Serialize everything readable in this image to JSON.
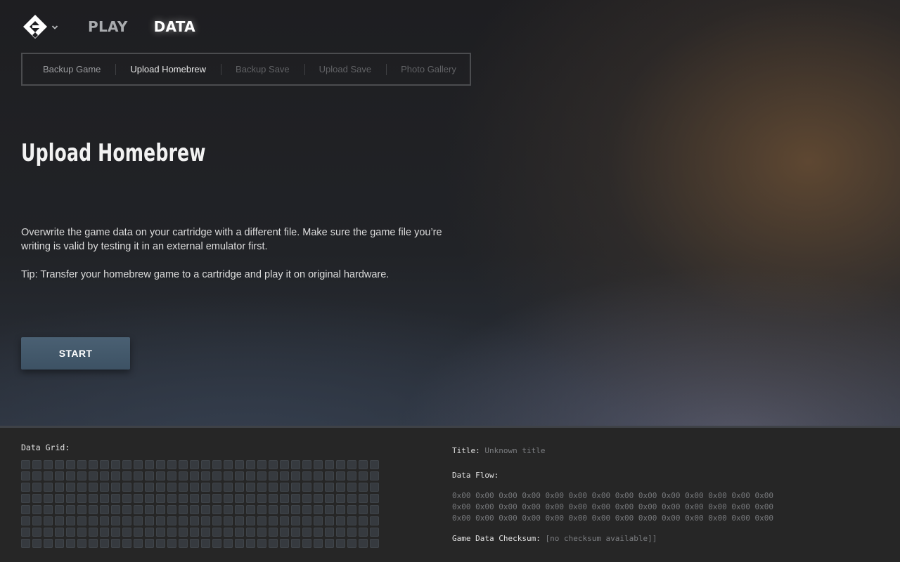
{
  "header": {
    "logo_icon": "cartridge-logo-icon",
    "logo_dropdown_icon": "chevron-down-icon",
    "nav": [
      {
        "label": "PLAY",
        "active": false
      },
      {
        "label": "DATA",
        "active": true
      }
    ]
  },
  "subnav": {
    "tabs": [
      {
        "label": "Backup Game",
        "state": "normal"
      },
      {
        "label": "Upload Homebrew",
        "state": "selected"
      },
      {
        "label": "Backup Save",
        "state": "disabled"
      },
      {
        "label": "Upload Save",
        "state": "disabled"
      },
      {
        "label": "Photo Gallery",
        "state": "disabled"
      }
    ]
  },
  "main": {
    "title": "Upload Homebrew",
    "description": "Overwrite the game data on your cartridge with a different file. Make sure the game file you’re writing is valid by testing it in an external emulator first.",
    "tip": "Tip: Transfer your homebrew game to a cartridge and play it on original hardware.",
    "start_label": "START"
  },
  "bottom": {
    "grid_label": "Data Grid:",
    "grid_rows": 8,
    "grid_cols": 32,
    "title_key": "Title:",
    "title_value": "Unknown title",
    "flow_label": "Data Flow:",
    "flow_lines": [
      "0x00 0x00 0x00 0x00 0x00 0x00 0x00 0x00 0x00 0x00 0x00 0x00 0x00 0x00",
      "0x00 0x00 0x00 0x00 0x00 0x00 0x00 0x00 0x00 0x00 0x00 0x00 0x00 0x00",
      "0x00 0x00 0x00 0x00 0x00 0x00 0x00 0x00 0x00 0x00 0x00 0x00 0x00 0x00"
    ],
    "checksum_key": "Game Data Checksum:",
    "checksum_value": "[no checksum available]]"
  }
}
